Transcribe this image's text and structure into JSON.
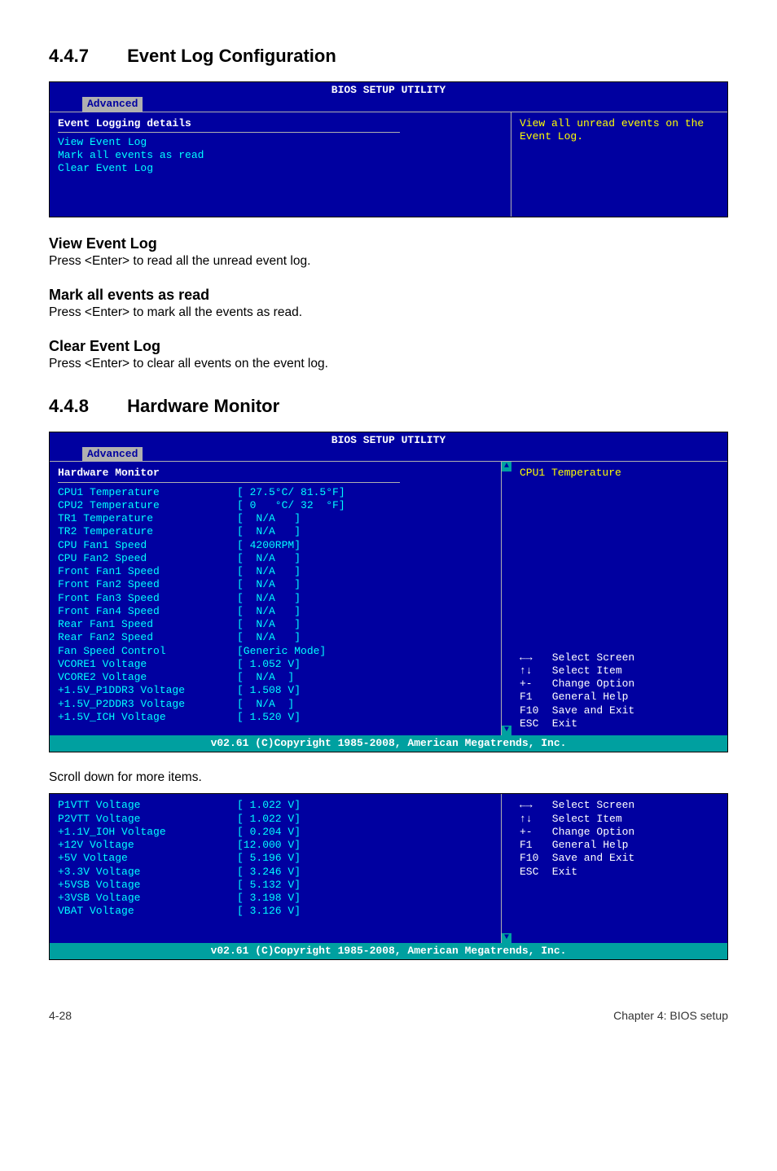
{
  "sections": {
    "eventLog": {
      "number": "4.4.7",
      "title": "Event Log Configuration",
      "bios": {
        "headerTitle": "BIOS SETUP UTILITY",
        "tab": "Advanced",
        "heading": "Event Logging details",
        "items": [
          "View Event Log",
          "Mark all events as read",
          "Clear Event Log"
        ],
        "sideHelp": "View all unread events on the Event Log."
      },
      "subs": [
        {
          "title": "View Event Log",
          "desc": "Press <Enter> to read all the unread event log."
        },
        {
          "title": "Mark all events as read",
          "desc": "Press <Enter> to mark all the events as read."
        },
        {
          "title": "Clear Event Log",
          "desc": "Press <Enter> to clear all events on the event log."
        }
      ]
    },
    "hwMonitor": {
      "number": "4.4.8",
      "title": "Hardware Monitor",
      "bios": {
        "headerTitle": "BIOS SETUP UTILITY",
        "tab": "Advanced",
        "heading": "Hardware Monitor",
        "footer": "v02.61 (C)Copyright 1985-2008, American Megatrends, Inc.",
        "rows": [
          {
            "label": "CPU1 Temperature",
            "value": "[ 27.5°C/ 81.5°F]"
          },
          {
            "label": "CPU2 Temperature",
            "value": "[ 0   °C/ 32  °F]"
          },
          {
            "label": "TR1 Temperature",
            "value": "[  N/A   ]"
          },
          {
            "label": "TR2 Temperature",
            "value": "[  N/A   ]"
          },
          {
            "label": "CPU Fan1 Speed",
            "value": "[ 4200RPM]"
          },
          {
            "label": "CPU Fan2 Speed",
            "value": "[  N/A   ]"
          },
          {
            "label": "Front Fan1 Speed",
            "value": "[  N/A   ]"
          },
          {
            "label": "Front Fan2 Speed",
            "value": "[  N/A   ]"
          },
          {
            "label": "Front Fan3 Speed",
            "value": "[  N/A   ]"
          },
          {
            "label": "Front Fan4 Speed",
            "value": "[  N/A   ]"
          },
          {
            "label": "Rear Fan1 Speed",
            "value": "[  N/A   ]"
          },
          {
            "label": "Rear Fan2 Speed",
            "value": "[  N/A   ]"
          },
          {
            "label": "Fan Speed Control",
            "value": "[Generic Mode]"
          },
          {
            "label": "VCORE1 Voltage",
            "value": "[ 1.052 V]"
          },
          {
            "label": "VCORE2 Voltage",
            "value": "[  N/A  ]"
          },
          {
            "label": "+1.5V_P1DDR3 Voltage",
            "value": "[ 1.508 V]"
          },
          {
            "label": "+1.5V_P2DDR3 Voltage",
            "value": "[  N/A  ]"
          },
          {
            "label": "+1.5V_ICH Voltage",
            "value": "[ 1.520 V]"
          }
        ],
        "sideTitle": "CPU1 Temperature",
        "nav": [
          {
            "key": "←→",
            "label": "Select Screen"
          },
          {
            "key": "↑↓",
            "label": "Select Item"
          },
          {
            "key": "+-",
            "label": "Change Option"
          },
          {
            "key": "F1",
            "label": "General Help"
          },
          {
            "key": "F10",
            "label": "Save and Exit"
          },
          {
            "key": "ESC",
            "label": "Exit"
          }
        ]
      },
      "scrollNote": "Scroll down for more items.",
      "bios2": {
        "footer": "v02.61 (C)Copyright 1985-2008, American Megatrends, Inc.",
        "rows": [
          {
            "label": "P1VTT Voltage",
            "value": "[ 1.022 V]"
          },
          {
            "label": "P2VTT Voltage",
            "value": "[ 1.022 V]"
          },
          {
            "label": "+1.1V_IOH Voltage",
            "value": "[ 0.204 V]"
          },
          {
            "label": "+12V Voltage",
            "value": "[12.000 V]"
          },
          {
            "label": "+5V Voltage",
            "value": "[ 5.196 V]"
          },
          {
            "label": "+3.3V Voltage",
            "value": "[ 3.246 V]"
          },
          {
            "label": "+5VSB Voltage",
            "value": "[ 5.132 V]"
          },
          {
            "label": "+3VSB Voltage",
            "value": "[ 3.198 V]"
          },
          {
            "label": "VBAT Voltage",
            "value": "[ 3.126 V]"
          }
        ],
        "nav": [
          {
            "key": "←→",
            "label": "Select Screen"
          },
          {
            "key": "↑↓",
            "label": "Select Item"
          },
          {
            "key": "+-",
            "label": "Change Option"
          },
          {
            "key": "F1",
            "label": "General Help"
          },
          {
            "key": "F10",
            "label": "Save and Exit"
          },
          {
            "key": "ESC",
            "label": "Exit"
          }
        ]
      }
    }
  },
  "footer": {
    "left": "4-28",
    "right": "Chapter 4: BIOS setup"
  }
}
